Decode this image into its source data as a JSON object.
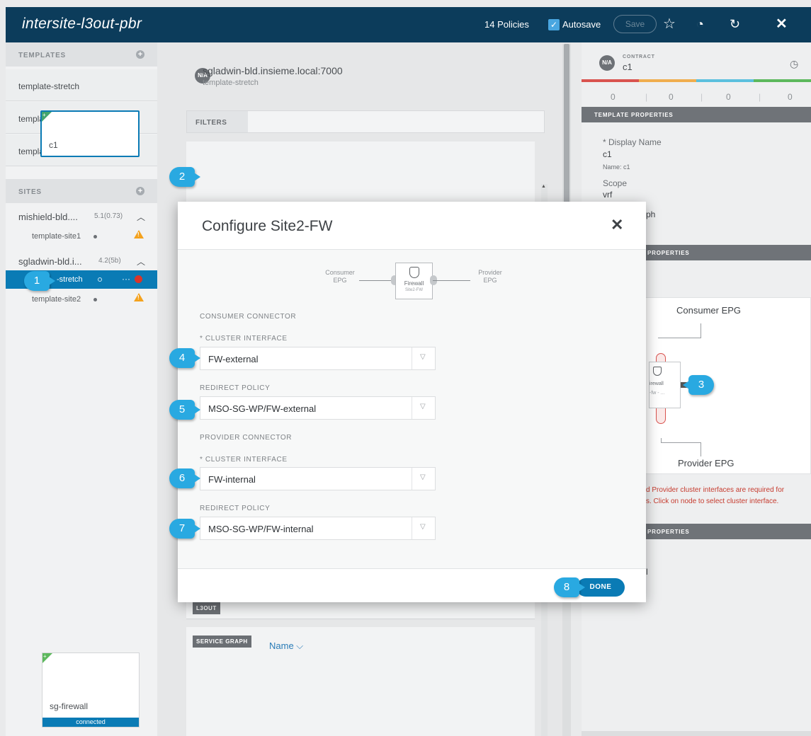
{
  "header": {
    "title": "intersite-l3out-pbr",
    "policies": "14 Policies",
    "autosave_label": "Autosave",
    "save_label": "Save",
    "icons": [
      "star-icon",
      "history-icon",
      "undo-icon",
      "close-icon"
    ]
  },
  "sidebar": {
    "templates_heading": "TEMPLATES",
    "templates": [
      "template-stretch",
      "template-site1",
      "template-site2"
    ],
    "sites_heading": "SITES",
    "sites": [
      {
        "name": "mishield-bld....",
        "version": "5.1(0.73)",
        "templates": [
          {
            "name": "template-site1",
            "status": "warning"
          }
        ]
      },
      {
        "name": "sgladwin-bld.i...",
        "version": "4.2(5b)",
        "templates": [
          {
            "name": "-stretch",
            "status": "error",
            "more": "···"
          },
          {
            "name": "template-site2",
            "status": "warning"
          }
        ]
      }
    ]
  },
  "middle": {
    "badge": "N/A",
    "host": "sgladwin-bld.insieme.local:7000",
    "template": "template-stretch",
    "filters_label": "FILTERS",
    "contract_card": "c1",
    "l3out_tag": "L3OUT",
    "service_graph_tag": "SERVICE GRAPH",
    "sort_label": "Name",
    "sg_card": {
      "name": "sg-firewall",
      "status": "connected"
    }
  },
  "right": {
    "badge": "N/A",
    "contract_label": "CONTRACT",
    "contract_name": "c1",
    "counts": [
      "0",
      "0",
      "0",
      "0"
    ],
    "colors": [
      "#d9534f",
      "#f0ad4e",
      "#5bc0de",
      "#5cb85c"
    ],
    "template_properties": "TEMPLATE PROPERTIES",
    "display_name_label": "* Display Name",
    "display_name_value": "c1",
    "name_small": "Name: c1",
    "scope_label": "Scope",
    "scope_value": "vrf",
    "service_graph_partial": "ph",
    "properties_head_1": "PROPERTIES",
    "consumer_epg": "Consumer EPG",
    "provider_epg": "Provider EPG",
    "node_label": "irewall",
    "node_sub": "-fw - ...",
    "note_line_1": "d Provider cluster interfaces are required for",
    "note_line_2": "s. Click on node to select cluster interface.",
    "properties_head_2": "PROPERTIES",
    "partial_letter": "l"
  },
  "modal": {
    "title": "Configure Site2-FW",
    "diagram": {
      "consumer": "Consumer\nEPG",
      "node": "Firewall",
      "node_sub": "Site2-FW",
      "provider": "Provider\nEPG"
    },
    "consumer_connector": "CONSUMER CONNECTOR",
    "provider_connector": "PROVIDER CONNECTOR",
    "cluster_interface_label": "* CLUSTER INTERFACE",
    "redirect_policy_label": "REDIRECT POLICY",
    "consumer_cluster_interface": "FW-external",
    "consumer_redirect_policy": "MSO-SG-WP/FW-external",
    "provider_cluster_interface": "FW-internal",
    "provider_redirect_policy": "MSO-SG-WP/FW-internal",
    "done_label": "DONE"
  },
  "callouts": [
    "1",
    "2",
    "3",
    "4",
    "5",
    "6",
    "7",
    "8"
  ]
}
